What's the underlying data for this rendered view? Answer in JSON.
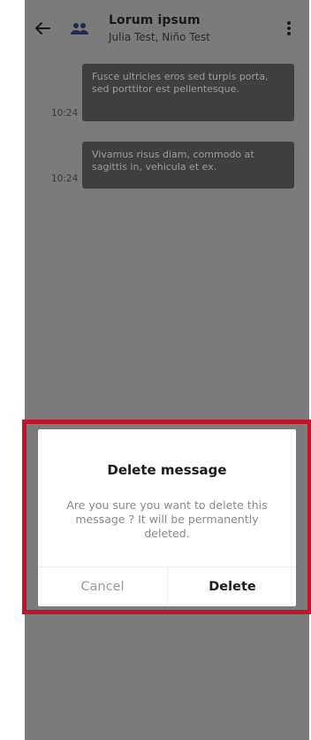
{
  "header": {
    "back_icon": "arrow-left-icon",
    "group_icon": "group-icon",
    "title": "Lorum ipsum",
    "subtitle": "Julia Test, Niño Test",
    "menu_icon": "more-vertical-icon"
  },
  "messages": [
    {
      "time": "10:24",
      "text": "Fusce ultricies eros sed turpis porta, sed porttitor est pellentesque."
    },
    {
      "time": "10:24",
      "text": "Vivamus risus diam, commodo at sagittis in, vehicula et ex."
    }
  ],
  "dialog": {
    "title": "Delete message",
    "body": "Are you sure you want to delete this message ? It will be permanently deleted.",
    "cancel_label": "Cancel",
    "delete_label": "Delete"
  },
  "colors": {
    "overlay_background": "#7b7b7b",
    "bubble_background": "#3f3f3f",
    "highlight_border": "#c0162b"
  }
}
